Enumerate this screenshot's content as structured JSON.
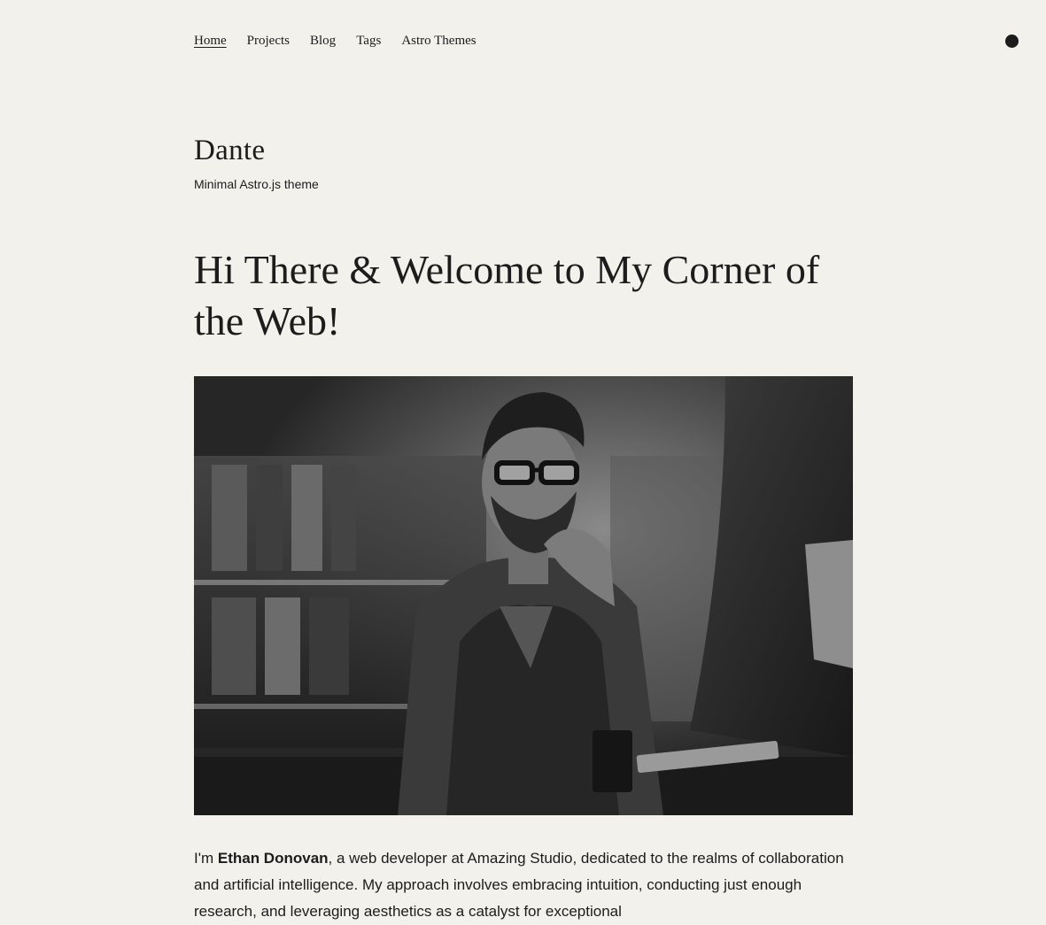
{
  "nav": {
    "items": [
      {
        "label": "Home",
        "active": true
      },
      {
        "label": "Projects",
        "active": false
      },
      {
        "label": "Blog",
        "active": false
      },
      {
        "label": "Tags",
        "active": false
      },
      {
        "label": "Astro Themes",
        "active": false
      }
    ]
  },
  "site": {
    "title": "Dante",
    "subtitle": "Minimal Astro.js theme"
  },
  "hero": {
    "heading": "Hi There & Welcome to My Corner of the Web!",
    "image_alt": "Man with glasses looking at a computer monitor"
  },
  "intro": {
    "prefix": "I'm ",
    "name": "Ethan Donovan",
    "text": ", a web developer at Amazing Studio, dedicated to the realms of collaboration and artificial intelligence. My approach involves embracing intuition, conducting just enough research, and leveraging aesthetics as a catalyst for exceptional"
  },
  "colors": {
    "background": "#f2f1ec",
    "text": "#1c1c1c"
  },
  "icons": {
    "theme_toggle": "theme-toggle-icon"
  }
}
